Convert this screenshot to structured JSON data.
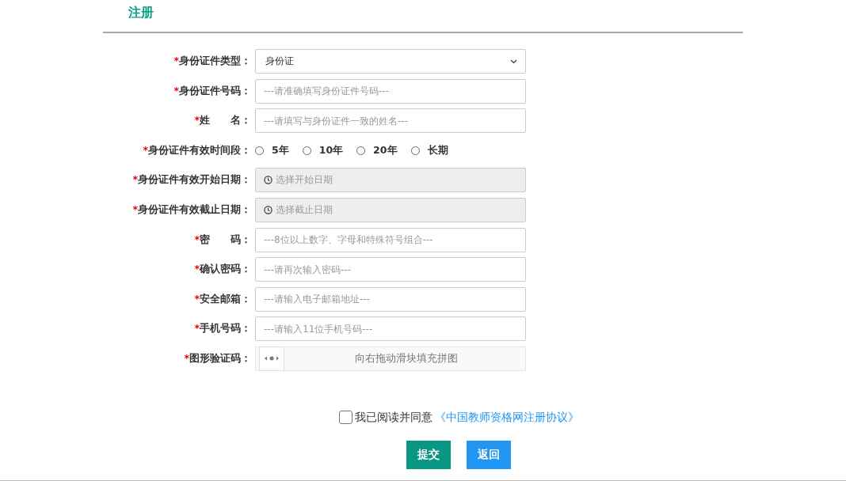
{
  "title": "注册",
  "fields": [
    {
      "kind": "select",
      "required_mark": "*",
      "label": "身份证件类型：",
      "value": "身份证"
    },
    {
      "kind": "text",
      "required_mark": "*",
      "label": "身份证件号码：",
      "placeholder": "---请准确填写身份证件号码---"
    },
    {
      "kind": "text",
      "required_mark": "*",
      "label": "姓　　名：",
      "placeholder": "---请填写与身份证件一致的姓名---"
    },
    {
      "kind": "radio",
      "required_mark": "*",
      "label": "身份证件有效时间段：",
      "options": [
        {
          "label": "5年",
          "selected": false
        },
        {
          "label": "10年",
          "selected": false
        },
        {
          "label": "20年",
          "selected": false
        },
        {
          "label": "长期",
          "selected": false
        }
      ]
    },
    {
      "kind": "date",
      "required_mark": "*",
      "label": "身份证件有效开始日期：",
      "placeholder": "选择开始日期"
    },
    {
      "kind": "date",
      "required_mark": "*",
      "label": "身份证件有效截止日期：",
      "placeholder": "选择截止日期"
    },
    {
      "kind": "text",
      "required_mark": "*",
      "label": "密　　码：",
      "placeholder": "---8位以上数字、字母和特殊符号组合---"
    },
    {
      "kind": "text",
      "required_mark": "*",
      "label": "确认密码：",
      "placeholder": "---请再次输入密码---"
    },
    {
      "kind": "text",
      "required_mark": "*",
      "label": "安全邮箱：",
      "placeholder": "---请输入电子邮箱地址---"
    },
    {
      "kind": "text",
      "required_mark": "*",
      "label": "手机号码：",
      "placeholder": "---请输入11位手机号码---"
    },
    {
      "kind": "slider",
      "required_mark": "*",
      "label": "图形验证码：",
      "hint": "向右拖动滑块填充拼图",
      "level": 0
    }
  ],
  "agreement": {
    "checked": false,
    "text": "我已阅读并同意",
    "link": "《中国教师资格网注册协议》"
  },
  "buttons": [
    {
      "kind": "submit",
      "label": "提交"
    },
    {
      "kind": "back",
      "label": "返回"
    }
  ]
}
